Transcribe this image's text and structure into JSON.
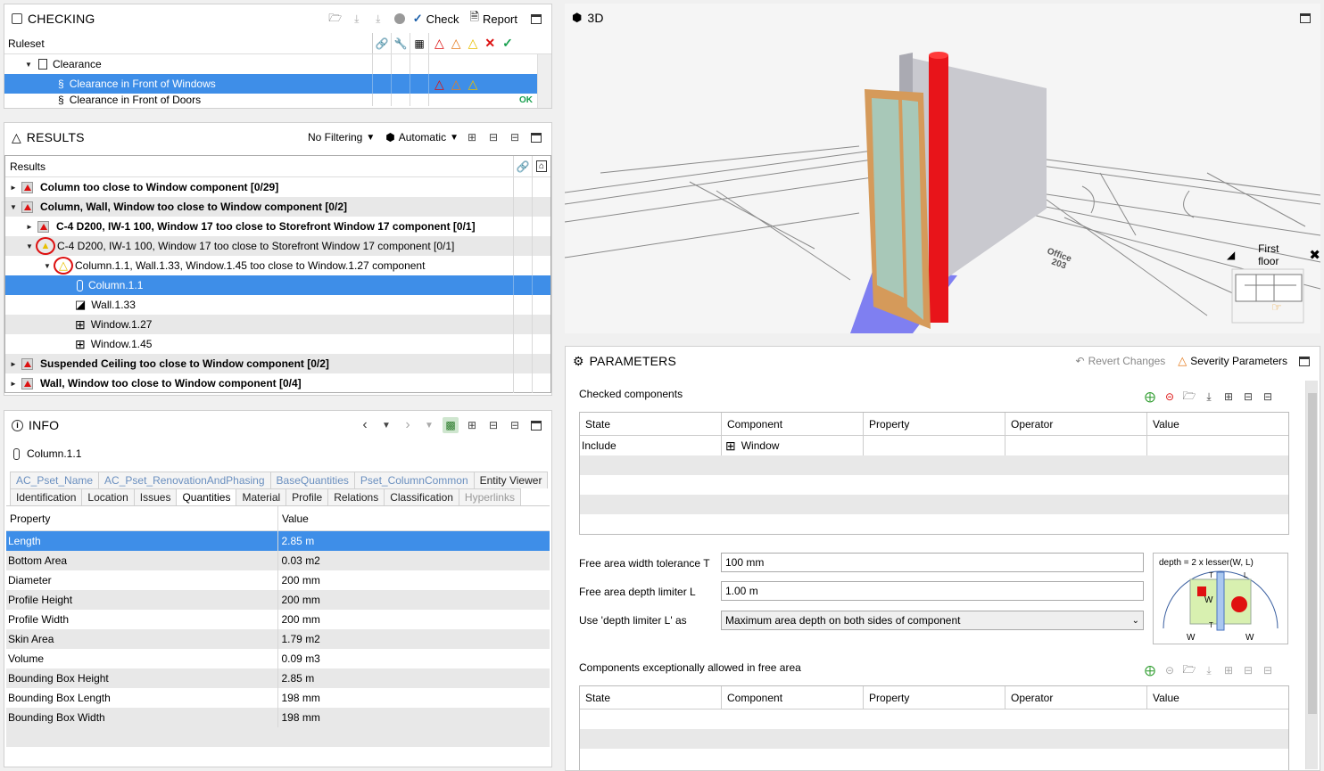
{
  "checking": {
    "title": "CHECKING",
    "check_label": "Check",
    "report_label": "Report",
    "ruleset_header": "Ruleset",
    "rows": [
      {
        "label": "Clearance"
      },
      {
        "label": "Clearance in Front of Windows"
      },
      {
        "label": "Clearance in Front of Doors",
        "status": "OK"
      }
    ]
  },
  "results": {
    "title": "RESULTS",
    "filter_label": "No Filtering",
    "mode_label": "Automatic",
    "column_header": "Results",
    "rows": [
      {
        "label": "Column too close to Window component [0/29]"
      },
      {
        "label": "Column, Wall, Window too close to Window component [0/2]"
      },
      {
        "label": "C-4 D200, IW-1 100, Window 17 too close to Storefront Window 17 component [0/1]"
      },
      {
        "label": "C-4 D200, IW-1 100, Window 17 too close to Storefront Window 17 component [0/1]"
      },
      {
        "label": "Column.1.1, Wall.1.33, Window.1.45 too close to Window.1.27 component"
      },
      {
        "label": "Column.1.1"
      },
      {
        "label": "Wall.1.33"
      },
      {
        "label": "Window.1.27"
      },
      {
        "label": "Window.1.45"
      },
      {
        "label": "Suspended Ceiling too close to Window component [0/2]"
      },
      {
        "label": "Wall, Window too close to Window component [0/4]"
      }
    ]
  },
  "info": {
    "title": "INFO",
    "selected": "Column.1.1",
    "tabs_top": [
      "AC_Pset_Name",
      "AC_Pset_RenovationAndPhasing",
      "BaseQuantities",
      "Pset_ColumnCommon",
      "Entity Viewer"
    ],
    "tabs_bottom": [
      "Identification",
      "Location",
      "Issues",
      "Quantities",
      "Material",
      "Profile",
      "Relations",
      "Classification",
      "Hyperlinks"
    ],
    "col_property": "Property",
    "col_value": "Value",
    "rows": [
      {
        "p": "Length",
        "v": "2.85 m"
      },
      {
        "p": "Bottom Area",
        "v": "0.03 m2"
      },
      {
        "p": "Diameter",
        "v": "200 mm"
      },
      {
        "p": "Profile Height",
        "v": "200 mm"
      },
      {
        "p": "Profile Width",
        "v": "200 mm"
      },
      {
        "p": "Skin Area",
        "v": "1.79 m2"
      },
      {
        "p": "Volume",
        "v": "0.09 m3"
      },
      {
        "p": "Bounding Box Height",
        "v": "2.85 m"
      },
      {
        "p": "Bounding Box Length",
        "v": "198 mm"
      },
      {
        "p": "Bounding Box Width",
        "v": "198 mm"
      }
    ]
  },
  "view3d": {
    "title": "3D",
    "floor_label": "First floor",
    "room_label": "Office",
    "room_number": "203"
  },
  "parameters": {
    "title": "PARAMETERS",
    "revert_label": "Revert Changes",
    "severity_label": "Severity Parameters",
    "checked_label": "Checked components",
    "grid_headers": [
      "State",
      "Component",
      "Property",
      "Operator",
      "Value"
    ],
    "checked_rows": [
      {
        "state": "Include",
        "component": "Window"
      }
    ],
    "tolerance_label": "Free area width tolerance T",
    "tolerance_value": "100 mm",
    "depth_label": "Free area depth limiter L",
    "depth_value": "1.00 m",
    "use_label": "Use 'depth limiter L' as",
    "use_value": "Maximum area depth on both sides of component",
    "diagram_formula": "depth = 2 x lesser(W, L)",
    "diagram_t": "T",
    "diagram_l": "L",
    "diagram_w": "W",
    "exceptions_label": "Components exceptionally allowed in free area"
  }
}
